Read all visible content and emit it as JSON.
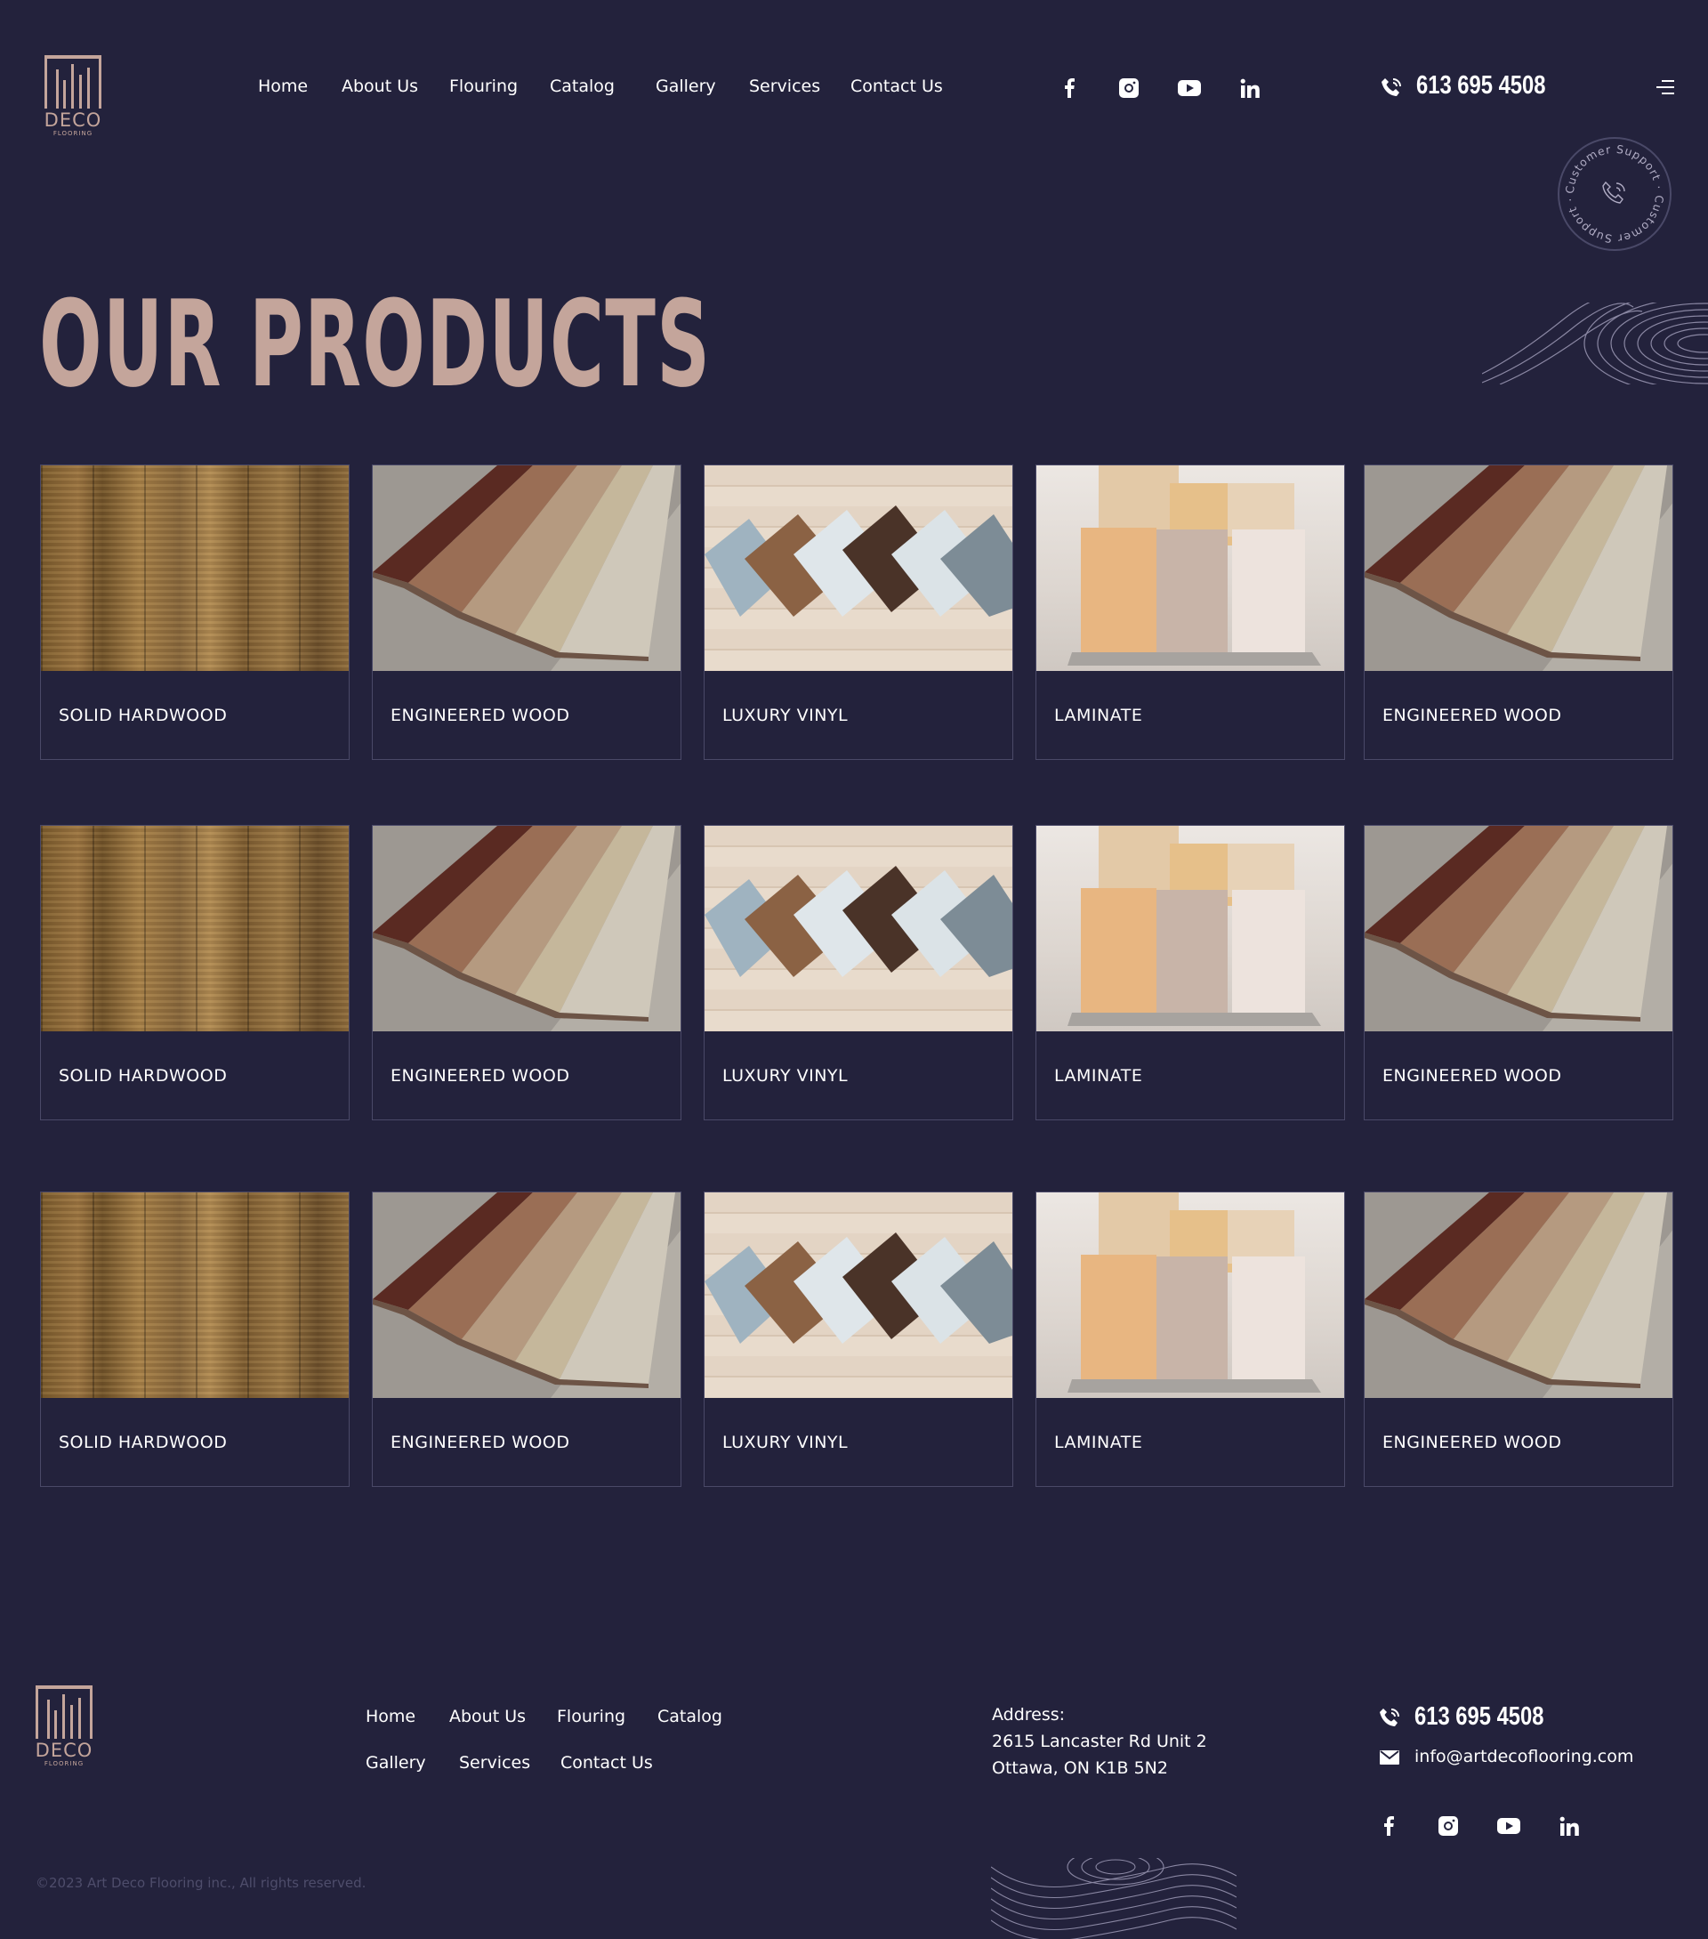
{
  "brand": {
    "logo_word": "DECO",
    "logo_sub": "FLOORING"
  },
  "nav": {
    "items": [
      {
        "label": "Home"
      },
      {
        "label": "About Us"
      },
      {
        "label": "Flouring"
      },
      {
        "label": "Catalog"
      },
      {
        "label": "Gallery"
      },
      {
        "label": "Services"
      },
      {
        "label": "Contact Us"
      }
    ]
  },
  "social": [
    "facebook-icon",
    "instagram-icon",
    "youtube-icon",
    "linkedin-icon"
  ],
  "phone": "613 695 4508",
  "support_badge": {
    "text": "Customer Support · Customer Support ·"
  },
  "page_title": "OUR PRODUCTS",
  "products": [
    {
      "label": "SOLID HARDWOOD",
      "image": "hardwood"
    },
    {
      "label": "ENGINEERED WOOD",
      "image": "engineered"
    },
    {
      "label": "LUXURY VINYL",
      "image": "vinyl"
    },
    {
      "label": "LAMINATE",
      "image": "laminate"
    },
    {
      "label": "ENGINEERED WOOD",
      "image": "engineered"
    },
    {
      "label": "SOLID HARDWOOD",
      "image": "hardwood"
    },
    {
      "label": "ENGINEERED WOOD",
      "image": "engineered"
    },
    {
      "label": "LUXURY VINYL",
      "image": "vinyl"
    },
    {
      "label": "LAMINATE",
      "image": "laminate"
    },
    {
      "label": "ENGINEERED WOOD",
      "image": "engineered"
    },
    {
      "label": "SOLID HARDWOOD",
      "image": "hardwood"
    },
    {
      "label": "ENGINEERED WOOD",
      "image": "engineered"
    },
    {
      "label": "LUXURY VINYL",
      "image": "vinyl"
    },
    {
      "label": "LAMINATE",
      "image": "laminate"
    },
    {
      "label": "ENGINEERED WOOD",
      "image": "engineered"
    }
  ],
  "footer": {
    "links_row1": [
      "Home",
      "About Us",
      "Flouring",
      "Catalog"
    ],
    "links_row2": [
      "Gallery",
      "Services",
      "Contact Us"
    ],
    "address_label": "Address:",
    "address_line1": "2615 Lancaster Rd Unit 2",
    "address_line2": "Ottawa, ON K1B 5N2",
    "phone": "613 695 4508",
    "email": "info@artdecoflooring.com",
    "copyright": "©2023 Art Deco Flooring inc., All rights reserved."
  },
  "colors": {
    "background": "#23223c",
    "accent": "#c4a59b",
    "card_border": "#4a4968",
    "text": "#ffffff"
  }
}
